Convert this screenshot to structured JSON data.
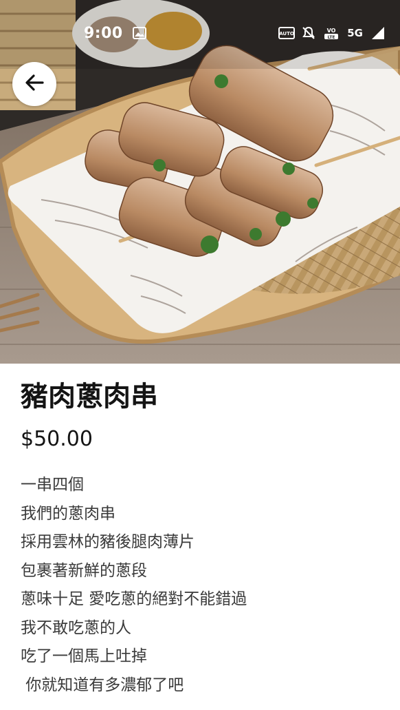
{
  "status_bar": {
    "time": "9:00",
    "network": "5G",
    "icons": [
      "image-icon",
      "auto-brightness-icon",
      "mute-icon",
      "volte-icon",
      "signal-icon"
    ]
  },
  "header": {
    "back_icon": "arrow-left-icon"
  },
  "product": {
    "title": "豬肉蔥肉串",
    "price": "$50.00",
    "description": [
      "一串四個",
      "我們的蔥肉串",
      "採用雲林的豬後腿肉薄片",
      "包裹著新鮮的蔥段",
      "蔥味十足 愛吃蔥的絕對不能錯過",
      "我不敢吃蔥的人",
      "吃了一個馬上吐掉",
      " 你就知道有多濃郁了吧"
    ]
  }
}
